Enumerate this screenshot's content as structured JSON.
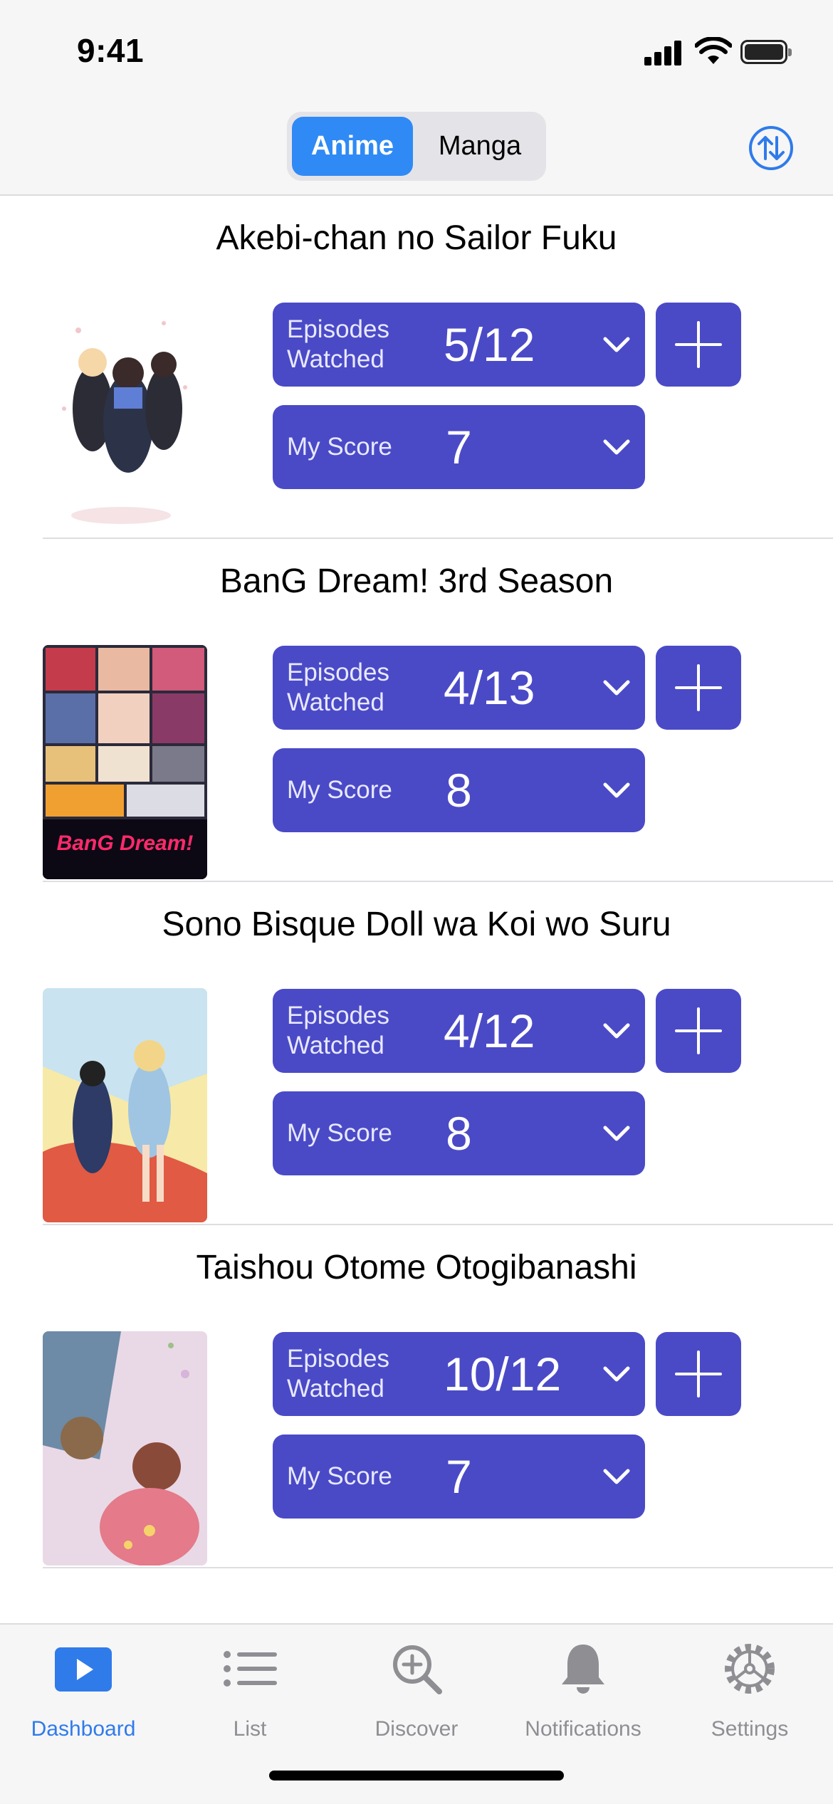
{
  "status_bar": {
    "time": "9:41"
  },
  "header": {
    "segments": [
      "Anime",
      "Manga"
    ],
    "selected_segment": "Anime",
    "sort_icon": "sort-arrows-icon"
  },
  "items": [
    {
      "title": "Akebi-chan no Sailor Fuku",
      "episodes_label": "Episodes Watched",
      "episodes_value": "5/12",
      "score_label": "My Score",
      "score_value": "7"
    },
    {
      "title": "BanG Dream! 3rd Season",
      "episodes_label": "Episodes Watched",
      "episodes_value": "4/13",
      "score_label": "My Score",
      "score_value": "8",
      "poster_text": "BanG Dream!"
    },
    {
      "title": "Sono Bisque Doll wa Koi wo Suru",
      "episodes_label": "Episodes Watched",
      "episodes_value": "4/12",
      "score_label": "My Score",
      "score_value": "8"
    },
    {
      "title": "Taishou Otome Otogibanashi",
      "episodes_label": "Episodes Watched",
      "episodes_value": "10/12",
      "score_label": "My Score",
      "score_value": "7"
    }
  ],
  "tabbar": {
    "tabs": [
      {
        "label": "Dashboard",
        "icon": "play-rectangle-icon",
        "active": true
      },
      {
        "label": "List",
        "icon": "list-icon",
        "active": false
      },
      {
        "label": "Discover",
        "icon": "magnifier-plus-icon",
        "active": false
      },
      {
        "label": "Notifications",
        "icon": "bell-icon",
        "active": false
      },
      {
        "label": "Settings",
        "icon": "gear-icon",
        "active": false
      }
    ]
  },
  "colors": {
    "accent": "#2f8af5",
    "pill": "#4a4ac7",
    "inactive_tab": "#8e8e93"
  }
}
